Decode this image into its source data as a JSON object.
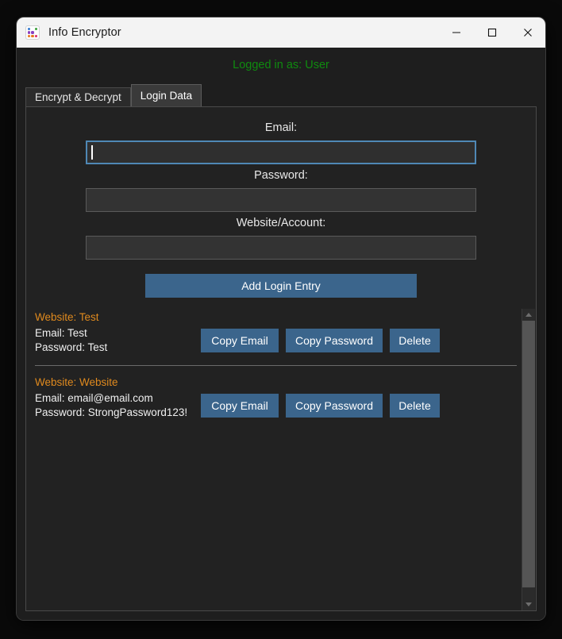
{
  "window": {
    "title": "Info Encryptor",
    "icon": "app-dots-icon",
    "icon_dots": [
      "#2f78d0",
      "#2b2b2b",
      "#3aa13a",
      "#8a3fc0",
      "#8a3fc0",
      "#2b2b2b",
      "#e8761a",
      "#e8761a",
      "#d92b6a"
    ],
    "controls": {
      "minimize": "minimize-icon",
      "maximize": "maximize-icon",
      "close": "close-icon"
    }
  },
  "status": {
    "logged_in_text": "Logged in as: User",
    "color": "#0f8b0f"
  },
  "tabs": [
    {
      "label": "Encrypt & Decrypt",
      "active": false
    },
    {
      "label": "Login Data",
      "active": true
    }
  ],
  "form": {
    "email": {
      "label": "Email:",
      "value": "",
      "placeholder": "",
      "focused": true
    },
    "password": {
      "label": "Password:",
      "value": "",
      "placeholder": "",
      "focused": false
    },
    "website": {
      "label": "Website/Account:",
      "value": "",
      "placeholder": "",
      "focused": false
    },
    "submit_label": "Add Login Entry"
  },
  "entries": [
    {
      "site_line": "Website: Test",
      "email_line": "Email: Test",
      "password_line": "Password: Test",
      "copy_email_label": "Copy Email",
      "copy_password_label": "Copy Password",
      "delete_label": "Delete"
    },
    {
      "site_line": "Website: Website",
      "email_line": "Email: email@email.com",
      "password_line": "Password: StrongPassword123!",
      "copy_email_label": "Copy Email",
      "copy_password_label": "Copy Password",
      "delete_label": "Delete"
    }
  ],
  "scrollbar": {
    "up_arrow": "scroll-up-arrow-icon",
    "down_arrow": "scroll-down-arrow-icon"
  },
  "theme": {
    "accent_button": "#3b658c",
    "entry_site_color": "#e08a1e",
    "focus_border": "#4f88b5",
    "window_bg": "#1e1e1e",
    "titlebar_bg": "#f3f3f3"
  }
}
